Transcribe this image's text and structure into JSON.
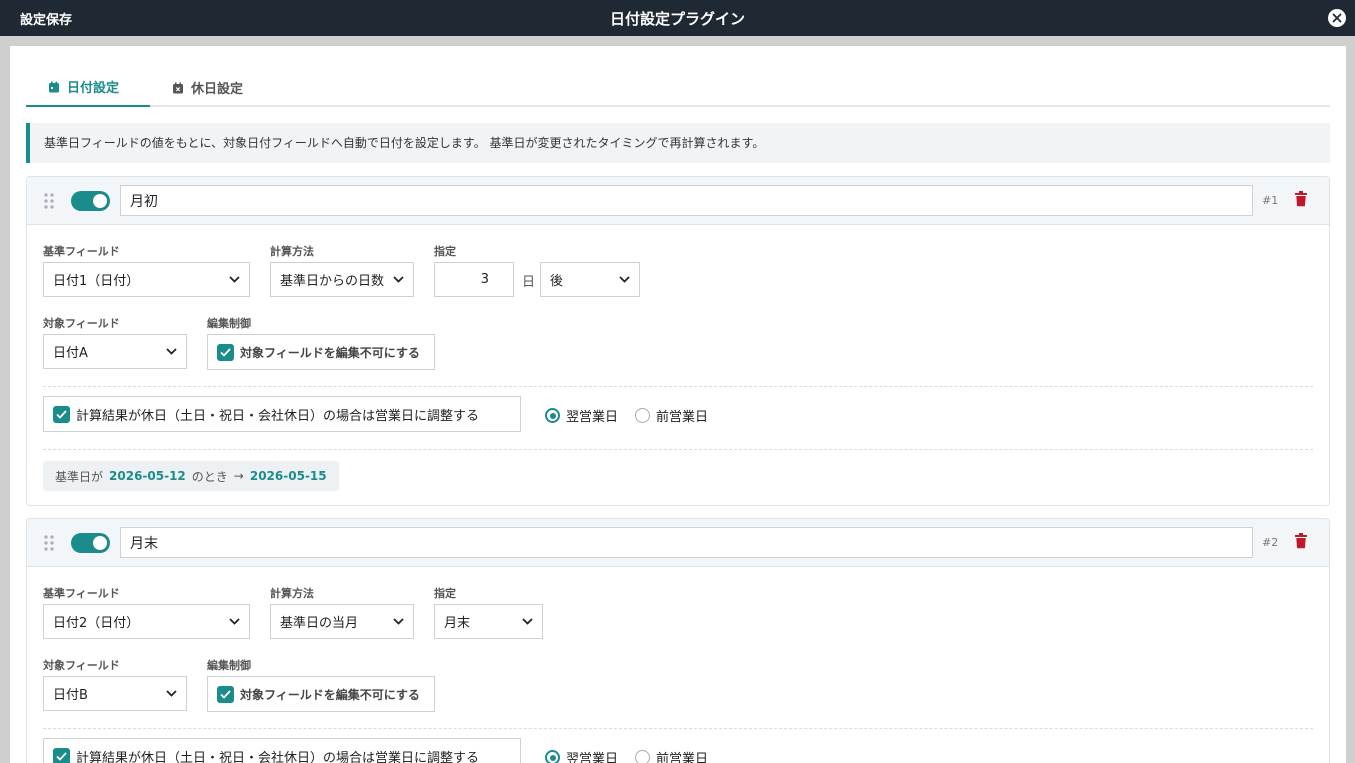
{
  "titlebar": {
    "save_label": "設定保存",
    "title": "日付設定プラグイン"
  },
  "tabs": [
    {
      "label": "日付設定",
      "active": true
    },
    {
      "label": "休日設定",
      "active": false
    }
  ],
  "info": "基準日フィールドの値をもとに、対象日付フィールドへ自動で日付を設定します。 基準日が変更されたタイミングで再計算されます。",
  "labels": {
    "base_field": "基準フィールド",
    "method": "計算方法",
    "spec": "指定",
    "target_field": "対象フィールド",
    "edit_control": "編集制御",
    "day_unit": "日"
  },
  "colors": {
    "accent": "#1a8c8c",
    "titlebar": "#1e2933",
    "delete": "#c0182b"
  },
  "rules": [
    {
      "enabled": true,
      "name": "月初",
      "index": "#1",
      "base_field": "日付1（日付）",
      "method": "基準日からの日数",
      "offset_value": "3",
      "offset_dir": "後",
      "target_field": "日付A",
      "edit_lock": "対象フィールドを編集不可にする",
      "holiday_adjust": "計算結果が休日（土日・祝日・会社休日）の場合は営業日に調整する",
      "radio_next": "翌営業日",
      "radio_prev": "前営業日",
      "preview": {
        "prefix": "基準日が",
        "base_date": "2026-05-12",
        "middle": "のとき",
        "arrow": "→",
        "result_date": "2026-05-15"
      }
    },
    {
      "enabled": true,
      "name": "月末",
      "index": "#2",
      "base_field": "日付2（日付）",
      "method": "基準日の当月",
      "spec": "月末",
      "target_field": "日付B",
      "edit_lock": "対象フィールドを編集不可にする",
      "holiday_adjust": "計算結果が休日（土日・祝日・会社休日）の場合は営業日に調整する",
      "radio_next": "翌営業日",
      "radio_prev": "前営業日"
    }
  ]
}
